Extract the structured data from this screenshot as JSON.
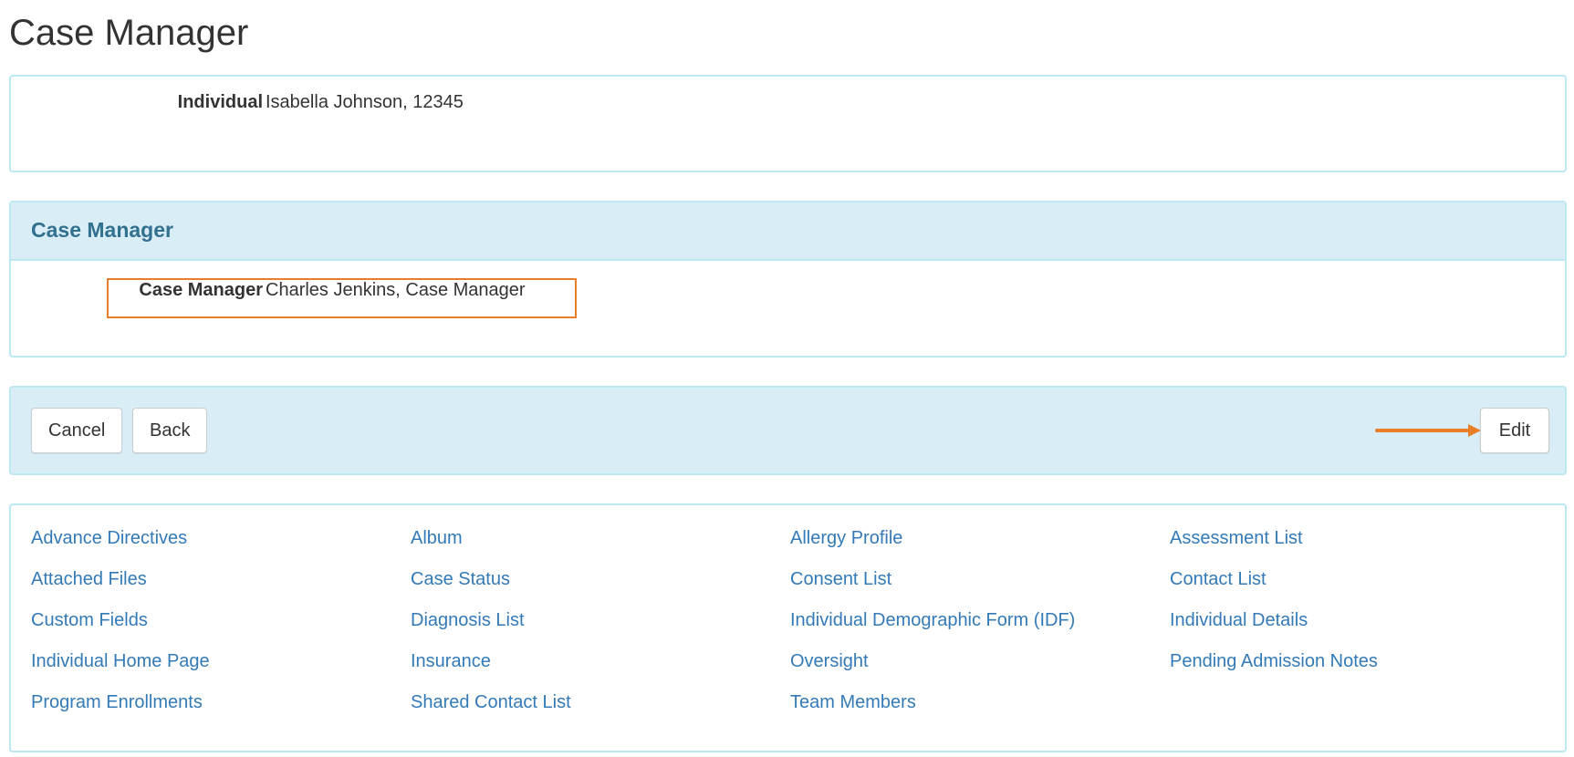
{
  "page": {
    "title": "Case Manager"
  },
  "individual": {
    "label": "Individual",
    "value": "Isabella Johnson, 12345"
  },
  "case_manager_panel": {
    "heading": "Case Manager",
    "label": "Case Manager",
    "value": "Charles Jenkins, Case Manager"
  },
  "actions": {
    "cancel_label": "Cancel",
    "back_label": "Back",
    "edit_label": "Edit"
  },
  "links": [
    "Advance Directives",
    "Album",
    "Allergy Profile",
    "Assessment List",
    "Attached Files",
    "Case Status",
    "Consent List",
    "Contact List",
    "Custom Fields",
    "Diagnosis List",
    "Individual Demographic Form (IDF)",
    "Individual Details",
    "Individual Home Page",
    "Insurance",
    "Oversight",
    "Pending Admission Notes",
    "Program Enrollments",
    "Shared Contact List",
    "Team Members"
  ],
  "colors": {
    "panel_border": "#bce8f1",
    "panel_heading_bg": "#d9edf7",
    "heading_text": "#31708f",
    "link": "#337ab7",
    "highlight": "#e87e27"
  },
  "icons": {
    "annotation_arrow": "arrow-right-icon"
  }
}
